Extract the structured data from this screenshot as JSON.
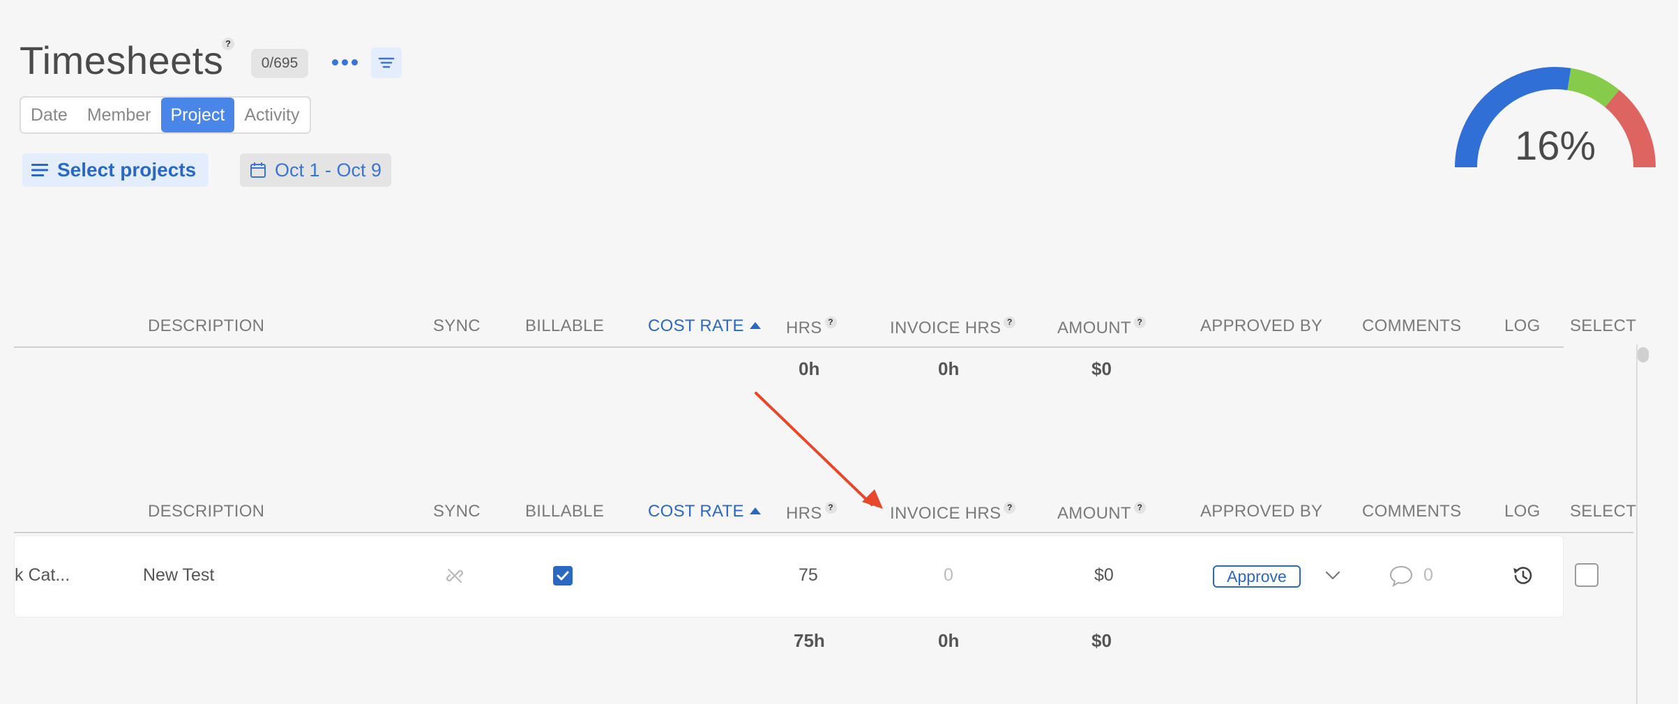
{
  "header": {
    "title": "Timesheets",
    "help_glyph": "?",
    "count_badge": "0/695",
    "more_icon": "more-horizontal-icon",
    "filter_icon": "filter-icon"
  },
  "view_tabs": [
    {
      "label": "Date",
      "active": false
    },
    {
      "label": "Member",
      "active": false
    },
    {
      "label": "Project",
      "active": true
    },
    {
      "label": "Activity",
      "active": false
    }
  ],
  "toolbar": {
    "select_projects_label": "Select projects",
    "date_range_label": "Oct 1 - Oct 9"
  },
  "gauge": {
    "percent_label": "16%",
    "segments": [
      {
        "fraction": 0.55,
        "color": "#3070d6"
      },
      {
        "fraction": 0.17,
        "color": "#86cc4a"
      },
      {
        "fraction": 0.28,
        "color": "#dd6461"
      }
    ]
  },
  "columns": {
    "description": "DESCRIPTION",
    "sync": "SYNC",
    "billable": "BILLABLE",
    "cost_rate": "COST RATE",
    "hrs": "HRS",
    "invoice_hrs": "INVOICE HRS",
    "amount": "AMOUNT",
    "approved_by": "APPROVED BY",
    "comments": "COMMENTS",
    "log": "LOG",
    "select": "SELECT"
  },
  "group1": {
    "totals": {
      "hrs": "0h",
      "invoice_hrs": "0h",
      "amount": "$0"
    }
  },
  "group2": {
    "row": {
      "project": "k Cat...",
      "description": "New Test",
      "billable": true,
      "hrs": "75",
      "invoice_hrs": "0",
      "amount": "$0",
      "approve_label": "Approve",
      "comments_count": "0"
    },
    "totals": {
      "hrs": "75h",
      "invoice_hrs": "0h",
      "amount": "$0"
    }
  },
  "colors": {
    "accent": "#2b68c4",
    "tab_active": "#4a86e8",
    "annotation_arrow": "#e8472b"
  }
}
